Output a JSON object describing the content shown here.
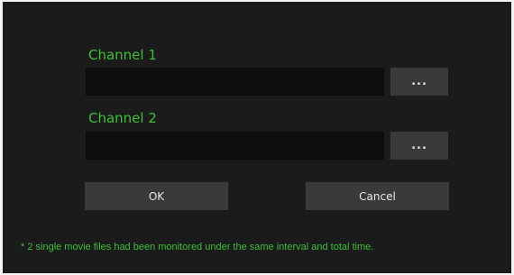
{
  "channel1": {
    "label": "Channel 1",
    "value": "",
    "browse_label": "..."
  },
  "channel2": {
    "label": "Channel 2",
    "value": "",
    "browse_label": "..."
  },
  "buttons": {
    "ok_label": "OK",
    "cancel_label": "Cancel"
  },
  "note": "* 2 single movie files had been monitored under the same interval and total time.",
  "colors": {
    "background": "#1b1b1b",
    "accent": "#3fbf3a",
    "field": "#0e0e0e",
    "button": "#3a3a3a"
  }
}
